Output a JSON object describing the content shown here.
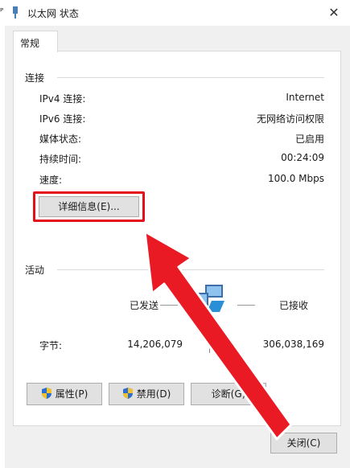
{
  "window": {
    "title": "以太网 状态"
  },
  "tabs": [
    {
      "label": "常规"
    }
  ],
  "connection": {
    "section_label": "连接",
    "rows": [
      {
        "label": "IPv4 连接:",
        "value": "Internet"
      },
      {
        "label": "IPv6 连接:",
        "value": "无网络访问权限"
      },
      {
        "label": "媒体状态:",
        "value": "已启用"
      },
      {
        "label": "持续时间:",
        "value": "00:24:09"
      },
      {
        "label": "速度:",
        "value": "100.0 Mbps"
      }
    ],
    "details_button": "详细信息(E)..."
  },
  "activity": {
    "section_label": "活动",
    "sent_label": "已发送",
    "received_label": "已接收",
    "bytes_label": "字节:",
    "bytes_sent": "14,206,079",
    "bytes_received": "306,038,169"
  },
  "buttons": {
    "properties": "属性(P)",
    "disable": "禁用(D)",
    "diagnose": "诊断(G)",
    "close": "关闭(C)"
  },
  "icons": {
    "title_icon": "network-adapter-icon",
    "activity_icon": "network-computers-icon",
    "shield_icon": "uac-shield-icon"
  },
  "colors": {
    "highlight_red": "#e3101c",
    "panel_bg": "#ffffff",
    "window_bg": "#f0f0f0"
  }
}
